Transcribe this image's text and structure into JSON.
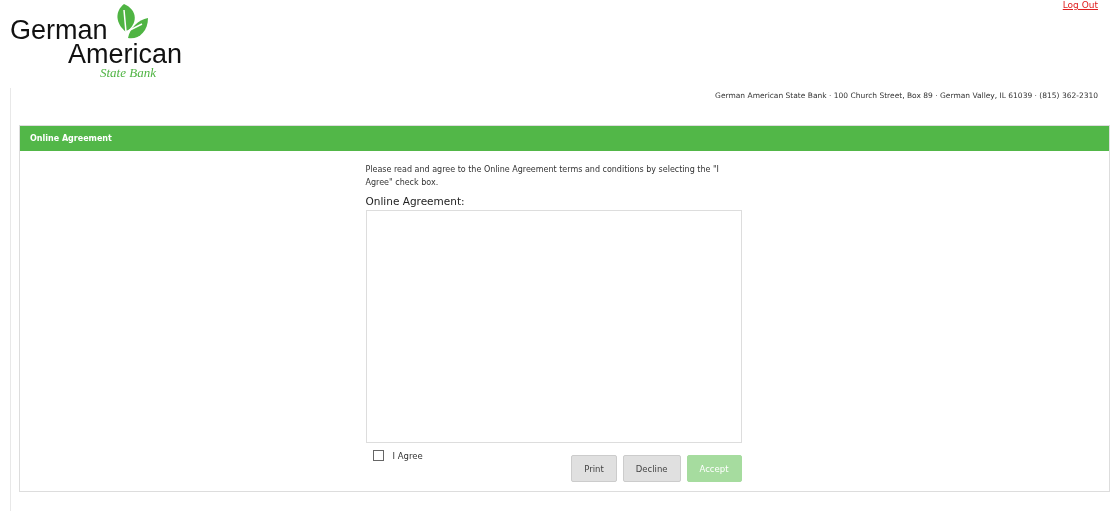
{
  "header": {
    "logout_link": "Log Out",
    "logo": {
      "line_1": "German",
      "line_2": "American",
      "line_3": "State Bank"
    },
    "address": "German American State Bank · 100 Church Street, Box 89 · German Valley, IL 61039 · (815) 362-2310"
  },
  "panel": {
    "title": "Online Agreement",
    "instructions": "Please read and agree to the Online Agreement terms and conditions by selecting the \"I Agree\" check box.",
    "agreement_label": "Online Agreement:",
    "agree_checkbox": {
      "label": "I Agree",
      "checked": false
    },
    "buttons": [
      {
        "label": "Print",
        "kind": "secondary",
        "disabled": false
      },
      {
        "label": "Decline",
        "kind": "secondary",
        "disabled": false
      },
      {
        "label": "Accept",
        "kind": "primary",
        "disabled": true
      }
    ]
  }
}
